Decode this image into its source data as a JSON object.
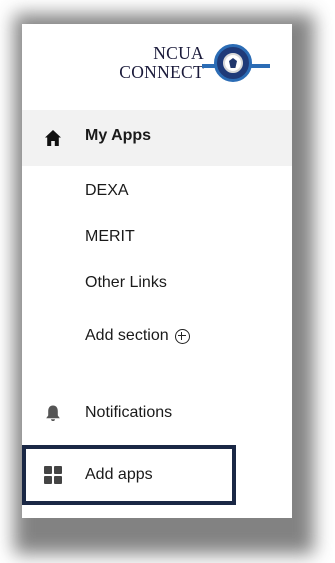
{
  "logo": {
    "line1": "NCUA",
    "line2": "CONNECT",
    "icon": "ncua-seal"
  },
  "nav": {
    "my_apps": {
      "label": "My Apps",
      "icon": "home-icon"
    },
    "apps": [
      {
        "label": "DEXA"
      },
      {
        "label": "MERIT"
      },
      {
        "label": "Other Links"
      }
    ],
    "add_section": {
      "label": "Add section",
      "icon": "plus-circle-icon"
    },
    "notifications": {
      "label": "Notifications",
      "icon": "bell-icon"
    },
    "add_apps": {
      "label": "Add apps",
      "icon": "grid-icon"
    }
  },
  "colors": {
    "active_bg": "#f2f2f2",
    "highlight_border": "#1a2845",
    "logo_accent": "#2b6cb5",
    "seal_blue": "#1f3a78"
  }
}
